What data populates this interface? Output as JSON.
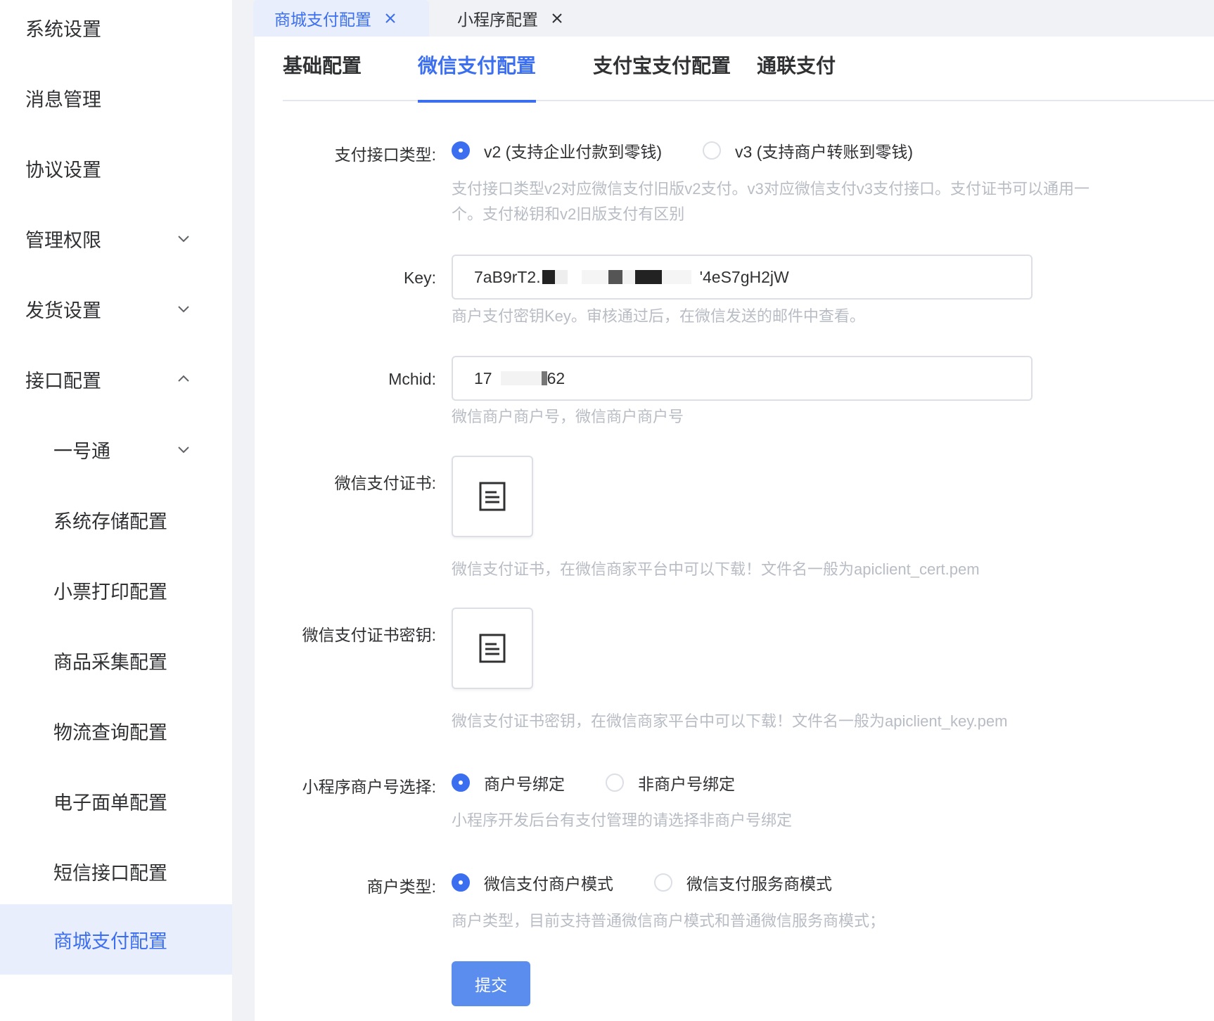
{
  "sidebar": {
    "items": [
      {
        "label": "系统设置"
      },
      {
        "label": "消息管理"
      },
      {
        "label": "协议设置"
      },
      {
        "label": "管理权限"
      },
      {
        "label": "发货设置"
      },
      {
        "label": "接口配置"
      },
      {
        "label": "一号通"
      },
      {
        "label": "系统存储配置"
      },
      {
        "label": "小票打印配置"
      },
      {
        "label": "商品采集配置"
      },
      {
        "label": "物流查询配置"
      },
      {
        "label": "电子面单配置"
      },
      {
        "label": "短信接口配置"
      },
      {
        "label": "商城支付配置"
      }
    ]
  },
  "tags": [
    {
      "label": "商城支付配置"
    },
    {
      "label": "小程序配置"
    }
  ],
  "tabs": [
    {
      "label": "基础配置"
    },
    {
      "label": "微信支付配置"
    },
    {
      "label": "支付宝支付配置"
    },
    {
      "label": "通联支付"
    }
  ],
  "form": {
    "pay_api_type": {
      "label": "支付接口类型:",
      "options": [
        "v2 (支持企业付款到零钱)",
        "v3 (支持商户转账到零钱)"
      ],
      "selected": "v2 (支持企业付款到零钱)",
      "hint_line1": "支付接口类型v2对应微信支付旧版v2支付。v3对应微信支付v3支付接口。支付证书可以通用一",
      "hint_line2": "个。支付秘钥和v2旧版支付有区别"
    },
    "key": {
      "label": "Key:",
      "value_start": "7aB9rT2.",
      "value_end": "'4eS7gH2jW",
      "hint": "商户支付密钥Key。审核通过后，在微信发送的邮件中查看。"
    },
    "mchid": {
      "label": "Mchid:",
      "value_start": "17",
      "value_end": "62",
      "hint": "微信商户商户号，微信商户商户号"
    },
    "cert": {
      "label": "微信支付证书:",
      "hint": "微信支付证书，在微信商家平台中可以下载！文件名一般为apiclient_cert.pem"
    },
    "cert_key": {
      "label": "微信支付证书密钥:",
      "hint": "微信支付证书密钥，在微信商家平台中可以下载！文件名一般为apiclient_key.pem"
    },
    "mini_merchant": {
      "label": "小程序商户号选择:",
      "options": [
        "商户号绑定",
        "非商户号绑定"
      ],
      "selected": "商户号绑定",
      "hint": "小程序开发后台有支付管理的请选择非商户号绑定"
    },
    "merchant_type": {
      "label": "商户类型:",
      "options": [
        "微信支付商户模式",
        "微信支付服务商模式"
      ],
      "selected": "微信支付商户模式",
      "hint": "商户类型，目前支持普通微信商户模式和普通微信服务商模式；"
    },
    "submit_label": "提交"
  },
  "colors": {
    "accent": "#3c6ff0",
    "active_bg": "#e8eefb",
    "hint": "#b8bcc4",
    "submit": "#5b8def"
  }
}
